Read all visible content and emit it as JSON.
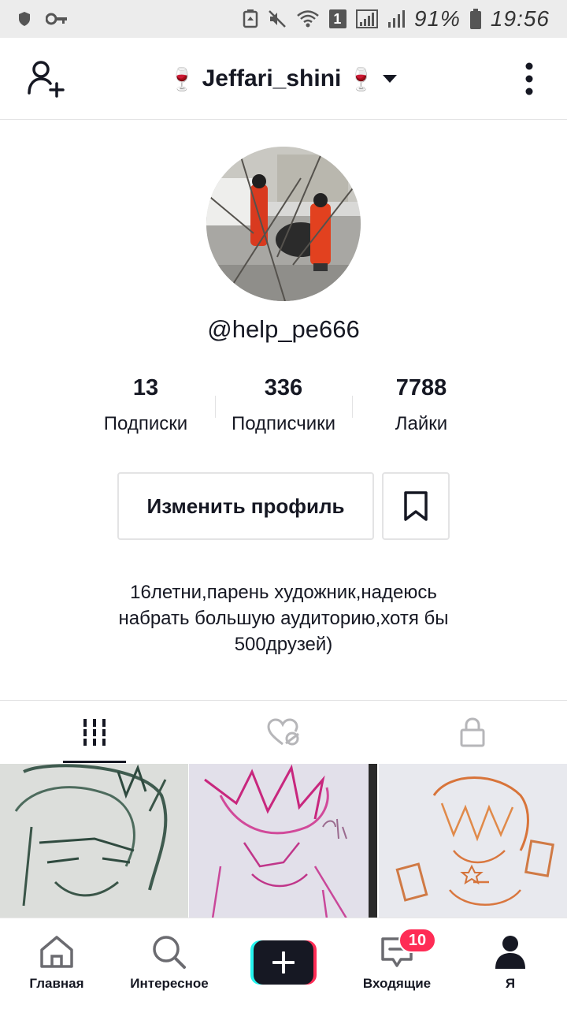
{
  "status_bar": {
    "battery": "91%",
    "time": "19:56",
    "sim_slot": "1"
  },
  "header": {
    "title_prefix_emoji": "🍷",
    "title": "Jeffari_shini",
    "title_suffix_emoji": "🍷"
  },
  "profile": {
    "username": "@help_pe666",
    "stats": [
      {
        "value": "13",
        "label": "Подписки"
      },
      {
        "value": "336",
        "label": "Подписчики"
      },
      {
        "value": "7788",
        "label": "Лайки"
      }
    ],
    "edit_button_label": "Изменить профиль",
    "bio_lines": [
      "16летни,парень художник,надеюсь",
      "набрать большую аудиторию,хотя бы",
      "500друзей)"
    ]
  },
  "tabs": [
    {
      "icon": "videos-grid-icon",
      "active": true
    },
    {
      "icon": "liked-hidden-icon",
      "active": false
    },
    {
      "icon": "lock-icon",
      "active": false
    }
  ],
  "bottom_nav": [
    {
      "label": "Главная",
      "icon": "home-icon"
    },
    {
      "label": "Интересное",
      "icon": "search-icon"
    },
    {
      "label": "",
      "icon": "create-plus-icon"
    },
    {
      "label": "Входящие",
      "icon": "inbox-icon",
      "badge": "10"
    },
    {
      "label": "Я",
      "icon": "profile-icon"
    }
  ],
  "colors": {
    "accent": "#fe2c55",
    "cyan": "#25f4ee",
    "text": "#161823",
    "divider": "#e3e3e4"
  }
}
